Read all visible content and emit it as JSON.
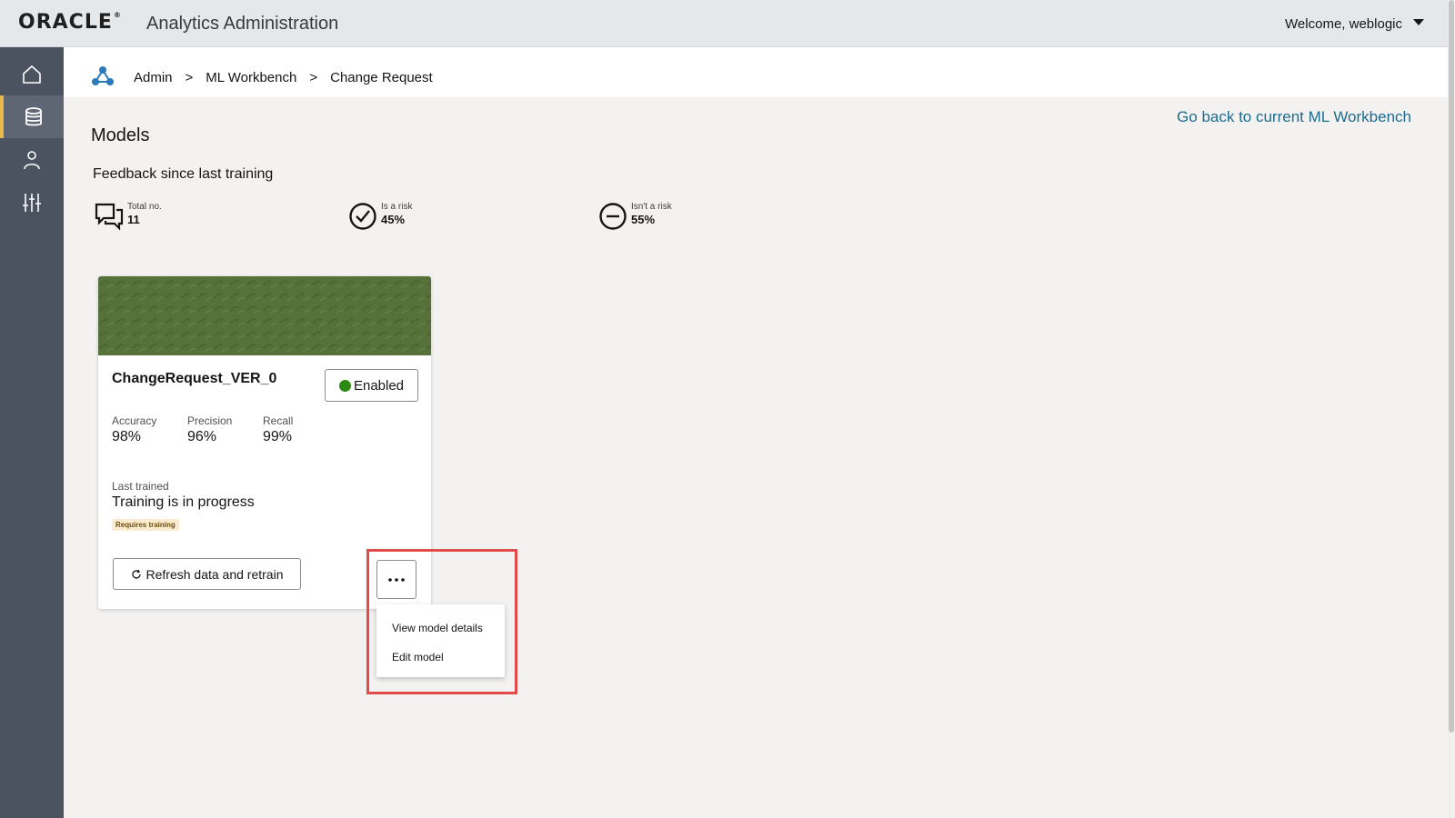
{
  "header": {
    "logo": "ORACLE",
    "logo_mark": "®",
    "app_title": "Analytics Administration",
    "welcome": "Welcome, weblogic"
  },
  "sidebar": {
    "items": [
      {
        "name": "home",
        "icon": "home-icon",
        "active": false
      },
      {
        "name": "data",
        "icon": "database-icon",
        "active": true
      },
      {
        "name": "users",
        "icon": "user-icon",
        "active": false
      },
      {
        "name": "settings",
        "icon": "sliders-icon",
        "active": false
      }
    ]
  },
  "breadcrumb": {
    "items": [
      "Admin",
      "ML Workbench",
      "Change Request"
    ],
    "separator": ">"
  },
  "back_link": "Go back to current ML Workbench",
  "models_title": "Models",
  "feedback": {
    "title": "Feedback since last training",
    "stats": [
      {
        "label": "Total no.",
        "value": "11",
        "icon": "chat-icon"
      },
      {
        "label": "Is a risk",
        "value": "45%",
        "icon": "check-circle-icon"
      },
      {
        "label": "Isn't a risk",
        "value": "55%",
        "icon": "minus-circle-icon"
      }
    ]
  },
  "card": {
    "name": "ChangeRequest_VER_0",
    "status": "Enabled",
    "status_color": "#2b8a12",
    "banner_color": "#56723a",
    "metrics": [
      {
        "label": "Accuracy",
        "value": "98%"
      },
      {
        "label": "Precision",
        "value": "96%"
      },
      {
        "label": "Recall",
        "value": "99%"
      }
    ],
    "last_trained_label": "Last trained",
    "last_trained_value": "Training is in progress",
    "badge": "Requires training",
    "refresh_button": "Refresh data and retrain"
  },
  "menu": {
    "items": [
      "View model details",
      "Edit model"
    ]
  },
  "colors": {
    "link": "#1c6c8f",
    "highlight": "#e24b4b",
    "sidebar_bg": "#4b5260",
    "active_indicator": "#e8b84a"
  }
}
